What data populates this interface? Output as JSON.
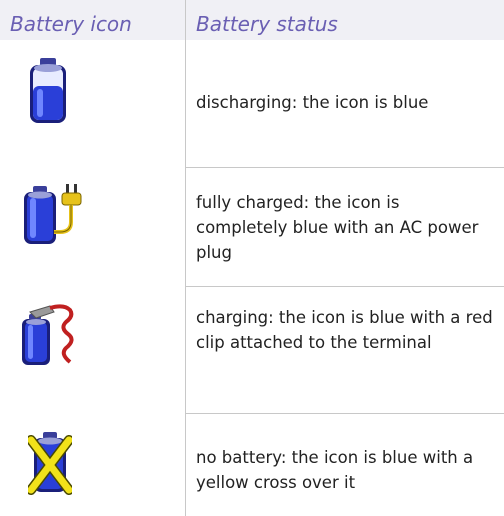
{
  "table": {
    "header": {
      "col_icon": "Battery icon",
      "col_status": "Battery status"
    },
    "rows": [
      {
        "icon": "battery-discharging-icon",
        "status": "discharging: the icon is blue"
      },
      {
        "icon": "battery-fully-charged-plug-icon",
        "status": "fully charged: the icon is completely blue with an AC power plug"
      },
      {
        "icon": "battery-charging-clip-icon",
        "status": "charging: the icon is blue with a red clip attached to the terminal"
      },
      {
        "icon": "no-battery-cross-icon",
        "status": "no battery: the icon is blue with a yellow cross over it"
      }
    ]
  },
  "colors": {
    "header_text": "#6a5fb3",
    "battery_blue": "#2a3fd8",
    "plug_yellow": "#e6c21a",
    "clip_red": "#c02020",
    "cross_yellow": "#f2e21a"
  }
}
